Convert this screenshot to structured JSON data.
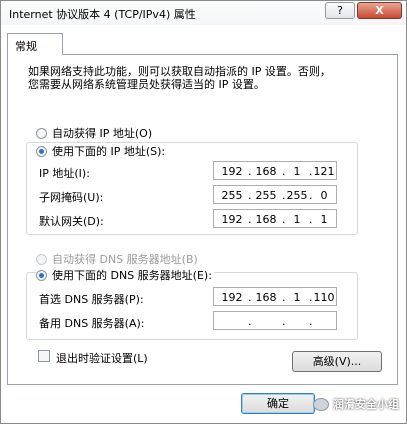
{
  "window": {
    "title": "Internet 协议版本 4 (TCP/IPv4) 属性",
    "help_label": "?",
    "close_label": "X"
  },
  "tabs": [
    {
      "label": "常规"
    }
  ],
  "description": "如果网络支持此功能，则可以获取自动指派的 IP 设置。否则，\n您需要从网络系统管理员处获得适当的 IP 设置。",
  "ip": {
    "auto_label": "自动获得 IP 地址(O)",
    "manual_label": "使用下面的 IP 地址(S):",
    "selected": "manual",
    "fields": [
      {
        "label": "IP 地址(I):",
        "octets": [
          "192",
          "168",
          "1",
          "121"
        ]
      },
      {
        "label": "子网掩码(U):",
        "octets": [
          "255",
          "255",
          "255",
          "0"
        ]
      },
      {
        "label": "默认网关(D):",
        "octets": [
          "192",
          "168",
          "1",
          "1"
        ]
      }
    ]
  },
  "dns": {
    "auto_label": "自动获得 DNS 服务器地址(B)",
    "manual_label": "使用下面的 DNS 服务器地址(E):",
    "selected": "manual",
    "auto_disabled": true,
    "fields": [
      {
        "label": "首选 DNS 服务器(P):",
        "octets": [
          "192",
          "168",
          "1",
          "110"
        ]
      },
      {
        "label": "备用 DNS 服务器(A):",
        "octets": [
          "",
          "",
          "",
          ""
        ]
      }
    ]
  },
  "validate_on_exit": {
    "label": "退出时验证设置(L)",
    "checked": false
  },
  "buttons": {
    "advanced": "高级(V)...",
    "ok": "确定"
  },
  "watermark": "润滑安全小组"
}
